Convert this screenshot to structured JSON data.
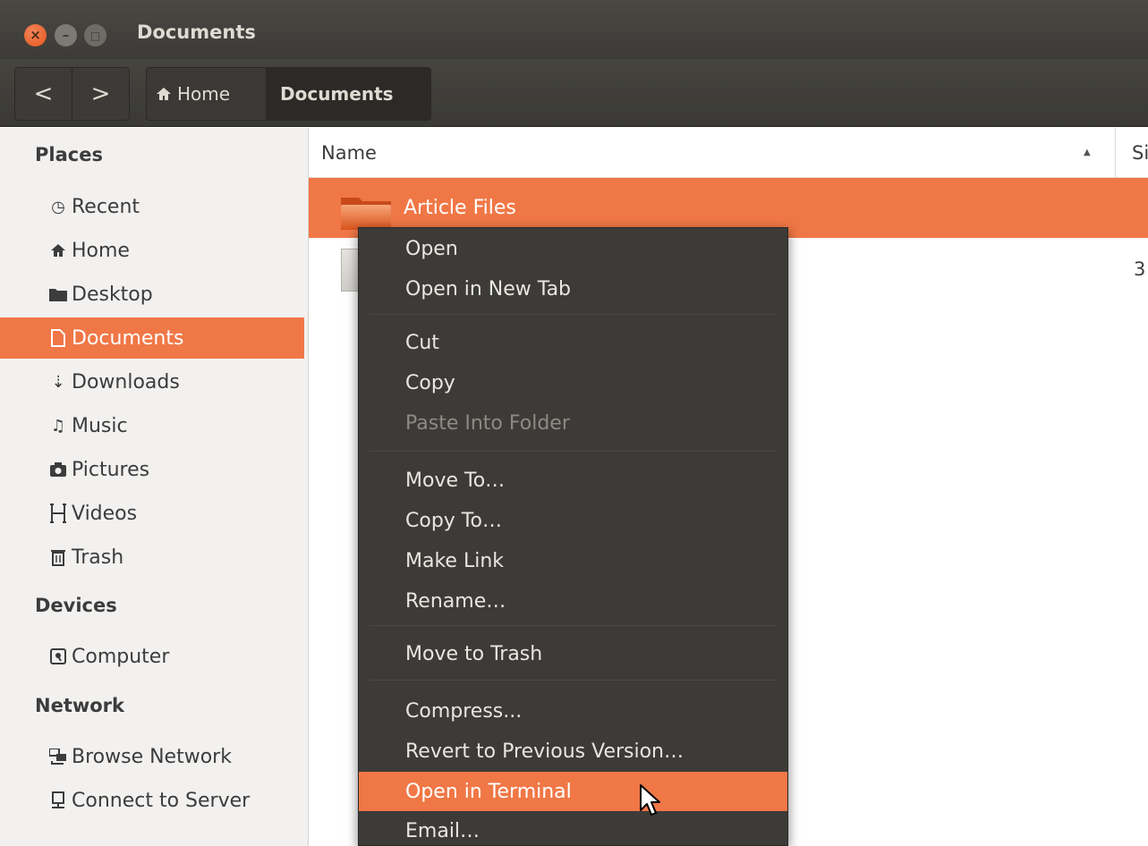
{
  "window": {
    "title": "Documents"
  },
  "toolbar": {
    "back_label": "<",
    "forward_label": ">",
    "breadcrumb": [
      {
        "label": "Home",
        "icon": "home-icon"
      },
      {
        "label": "Documents"
      }
    ]
  },
  "sidebar": {
    "sections": [
      {
        "title": "Places"
      },
      {
        "title": "Devices"
      },
      {
        "title": "Network"
      }
    ],
    "places": [
      {
        "label": "Recent",
        "icon": "clock-icon"
      },
      {
        "label": "Home",
        "icon": "home-icon"
      },
      {
        "label": "Desktop",
        "icon": "folder-icon"
      },
      {
        "label": "Documents",
        "icon": "document-icon",
        "active": true
      },
      {
        "label": "Downloads",
        "icon": "download-icon"
      },
      {
        "label": "Music",
        "icon": "music-icon"
      },
      {
        "label": "Pictures",
        "icon": "camera-icon"
      },
      {
        "label": "Videos",
        "icon": "film-icon"
      },
      {
        "label": "Trash",
        "icon": "trash-icon"
      }
    ],
    "devices": [
      {
        "label": "Computer",
        "icon": "drive-icon"
      }
    ],
    "network": [
      {
        "label": "Browse Network",
        "icon": "network-icon"
      },
      {
        "label": "Connect to Server",
        "icon": "server-icon"
      }
    ]
  },
  "file_view": {
    "columns": {
      "name": "Name",
      "size": "Si"
    },
    "files": [
      {
        "name": "Article Files",
        "type": "folder",
        "selected": true
      },
      {
        "name": "",
        "type": "file",
        "size": "3"
      }
    ]
  },
  "context_menu": {
    "items": [
      {
        "label": "Open"
      },
      {
        "label": "Open in New Tab"
      },
      {
        "label": "Cut"
      },
      {
        "label": "Copy"
      },
      {
        "label": "Paste Into Folder",
        "disabled": true
      },
      {
        "label": "Move To…"
      },
      {
        "label": "Copy To…"
      },
      {
        "label": "Make Link"
      },
      {
        "label": "Rename…"
      },
      {
        "label": "Move to Trash"
      },
      {
        "label": "Compress..."
      },
      {
        "label": "Revert to Previous Version…"
      },
      {
        "label": "Open in Terminal",
        "highlighted": true
      },
      {
        "label": "Email…"
      }
    ]
  },
  "colors": {
    "accent": "#f07746",
    "titlebar": "#3c3b37",
    "menu_bg": "#3c3b37",
    "sidebar_bg": "#f2f1f0"
  }
}
